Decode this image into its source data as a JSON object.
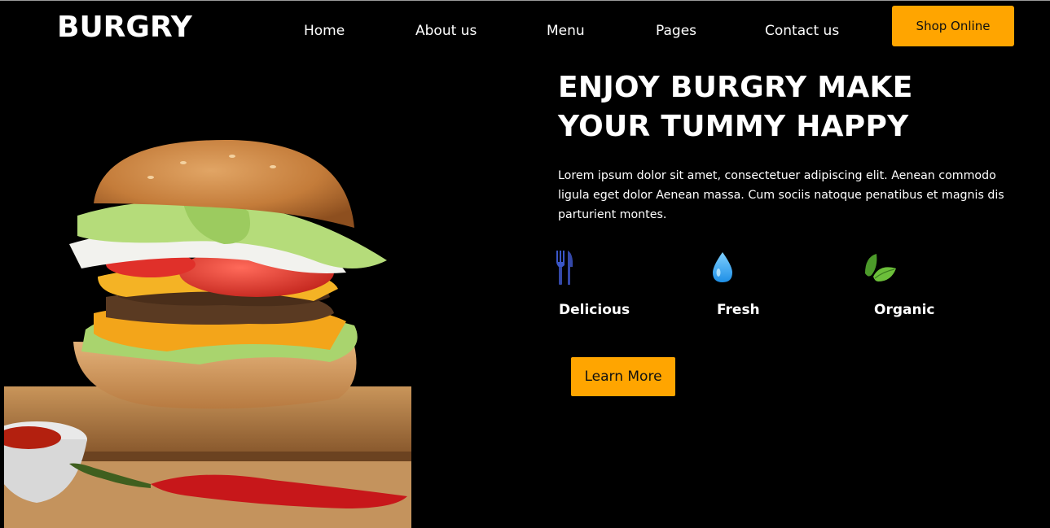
{
  "brand": {
    "logo": "BURGRY"
  },
  "nav": {
    "items": [
      {
        "label": "Home"
      },
      {
        "label": "About us"
      },
      {
        "label": "Menu"
      },
      {
        "label": "Pages"
      },
      {
        "label": "Contact us"
      }
    ],
    "shop_button": "Shop Online"
  },
  "hero": {
    "headline_line1": "ENJOY BURGRY MAKE",
    "headline_line2": "YOUR TUMMY HAPPY",
    "description": "Lorem ipsum dolor sit amet, consectetuer adipiscing elit. Aenean commodo ligula eget dolor Aenean massa. Cum sociis natoque penatibus et magnis dis parturient montes.",
    "features": [
      {
        "label": "Delicious",
        "icon": "fork-knife-icon"
      },
      {
        "label": "Fresh",
        "icon": "water-drop-icon"
      },
      {
        "label": "Organic",
        "icon": "leaf-icon"
      }
    ],
    "cta_button": "Learn More"
  },
  "colors": {
    "background": "#000000",
    "accent": "#ffa500",
    "text": "#ffffff"
  }
}
